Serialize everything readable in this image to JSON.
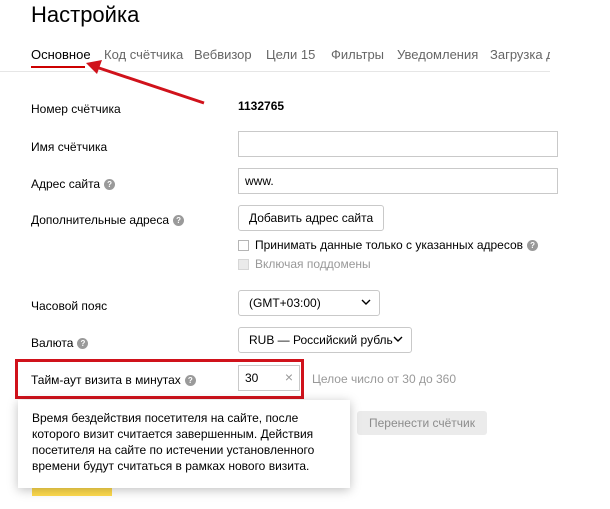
{
  "page": {
    "title": "Настройка"
  },
  "tabs": [
    {
      "label": "Основное",
      "active": true
    },
    {
      "label": "Код счётчика"
    },
    {
      "label": "Вебвизор"
    },
    {
      "label": "Цели 15"
    },
    {
      "label": "Фильтры"
    },
    {
      "label": "Уведомления"
    },
    {
      "label": "Загрузка д"
    }
  ],
  "form": {
    "counter_number": {
      "label": "Номер счётчика",
      "value": "1132765"
    },
    "counter_name": {
      "label": "Имя счётчика",
      "value": ""
    },
    "site_address": {
      "label": "Адрес сайта",
      "value": "www."
    },
    "extra_addresses": {
      "label": "Дополнительные адреса",
      "add_button": "Добавить адрес сайта",
      "accept_only_label": "Принимать данные только с указанных адресов",
      "include_subdomains_label": "Включая поддомены"
    },
    "timezone": {
      "label": "Часовой пояс",
      "value": "(GMT+03:00)"
    },
    "currency": {
      "label": "Валюта",
      "value": "RUB — Российский рубль"
    },
    "timeout": {
      "label": "Тайм-аут визита в минутах",
      "value": "30",
      "hint": "Целое число от 30 до 360"
    }
  },
  "tooltip": {
    "text": "Время бездействия посетителя на сайте, после которого визит считается завершенным. Действия посетителя на сайте по истечении установленного времени будут считаться в рамках нового визита."
  },
  "actions": {
    "move_counter": "Перенести счётчик"
  },
  "colors": {
    "accent_red": "#cc0000",
    "annotation_red": "#d0121b",
    "primary_yellow": "#ffdb4d"
  }
}
